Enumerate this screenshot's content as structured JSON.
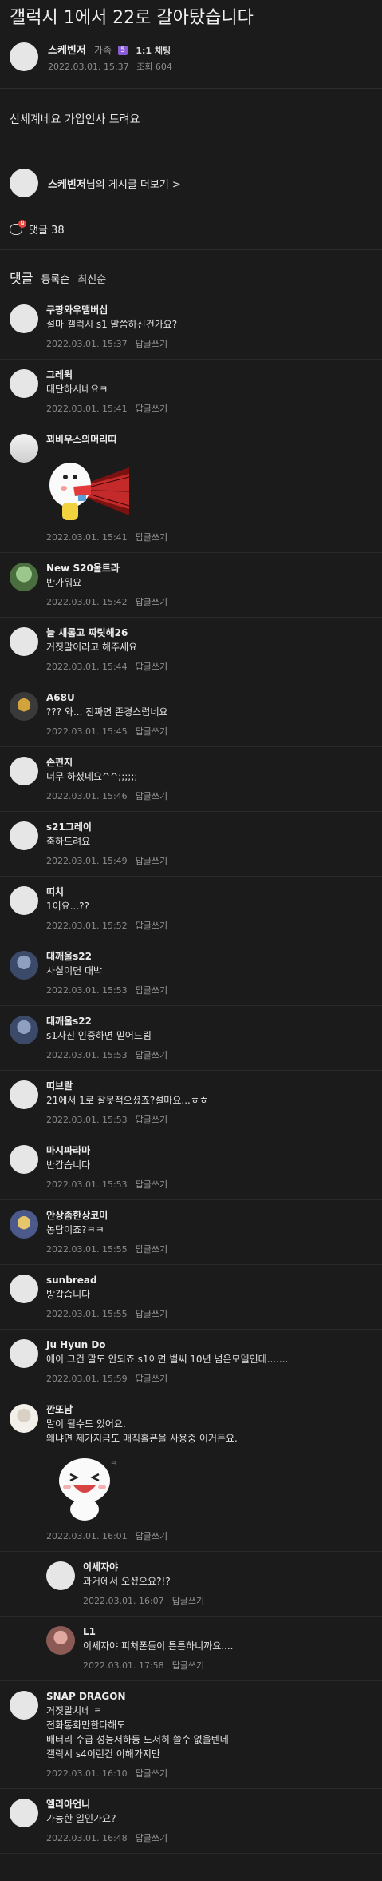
{
  "post": {
    "title": "갤럭시 1에서 22로 갈아탔습니다",
    "author": "스케빈저",
    "level": "가족",
    "level_badge": "5",
    "chat_label": "1:1 채팅",
    "date": "2022.03.01. 15:37",
    "views": "조회 604",
    "body": "신세계네요 가입인사 드려요",
    "more_link_name": "스케빈저",
    "more_link_suffix": "님의 게시글 더보기 >",
    "comment_count_label": "댓글 38",
    "comment_badge": "N"
  },
  "comments_section": {
    "title": "댓글",
    "sort_options": [
      "등록순",
      "최신순"
    ]
  },
  "reply_label": "답글쓰기",
  "comments": [
    {
      "name": "쿠팡와우맴버십",
      "text": "설마 갤럭시 s1 말씀하신건가요?",
      "date": "2022.03.01. 15:37"
    },
    {
      "name": "그레윅",
      "text": "대단하시네요ㅋ",
      "date": "2022.03.01. 15:41"
    },
    {
      "name": "꾀비우스의머리띠",
      "text": "",
      "date": "2022.03.01. 15:41",
      "sticker": "sticker-megaphone"
    },
    {
      "name": "New S20울트라",
      "text": "반가워요",
      "date": "2022.03.01. 15:42"
    },
    {
      "name": "늘 새롭고 짜릿해26",
      "text": "거짓말이라고 해주세요",
      "date": "2022.03.01. 15:44"
    },
    {
      "name": "A68U",
      "text": "??? 와... 진짜면 존경스럽네요",
      "date": "2022.03.01. 15:45"
    },
    {
      "name": "손편지",
      "text": "너무 하셨네요^^;;;;;;",
      "date": "2022.03.01. 15:46"
    },
    {
      "name": "s21그레이",
      "text": "축하드려요",
      "date": "2022.03.01. 15:49"
    },
    {
      "name": "띠치",
      "text": "1이요...??",
      "date": "2022.03.01. 15:52"
    },
    {
      "name": "대깨울s22",
      "text": "사실이면 대박",
      "date": "2022.03.01. 15:53"
    },
    {
      "name": "대깨울s22",
      "text": "s1사진 인증하면 믿어드림",
      "date": "2022.03.01. 15:53"
    },
    {
      "name": "띠브랄",
      "text": "21에서 1로 잘못적으셨죠?설마요...ㅎㅎ",
      "date": "2022.03.01. 15:53"
    },
    {
      "name": "마시파라마",
      "text": "반갑습니다",
      "date": "2022.03.01. 15:53"
    },
    {
      "name": "안상좀한상코미",
      "text": "농담이죠?ㅋㅋ",
      "date": "2022.03.01. 15:55"
    },
    {
      "name": "sunbread",
      "text": "방갑습니다",
      "date": "2022.03.01. 15:55"
    },
    {
      "name": "Ju Hyun Do",
      "text": "에이 그건 말도 안되죠 s1이면 벌써 10년 넘은모델인데.......",
      "date": "2022.03.01. 15:59"
    },
    {
      "name": "깐또남",
      "text": "말이 될수도 있어요.\n왜냐면 제가지금도 매직홀폰을 사용중 이거든요.",
      "date": "2022.03.01. 16:01",
      "sticker": "sticker-laugh"
    },
    {
      "name": "이세자야",
      "text": "과거에서 오셨으요?!?",
      "date": "2022.03.01. 16:07",
      "reply": true
    },
    {
      "name": "L1",
      "text": "이세자야 피처폰들이 튼튼하니까요....",
      "date": "2022.03.01. 17:58",
      "reply": true
    },
    {
      "name": "SNAP DRAGON",
      "text": "거짓말치네 ㅋ\n전화통화만한다해도\n배터리 수급 성능저하등 도저히 쓸수 없을텐데\n갤럭시 s4이런건 이해가지만",
      "date": "2022.03.01. 16:10"
    },
    {
      "name": "엘리아언니",
      "text": "가능한 일인가요?",
      "date": "2022.03.01. 16:48"
    }
  ]
}
